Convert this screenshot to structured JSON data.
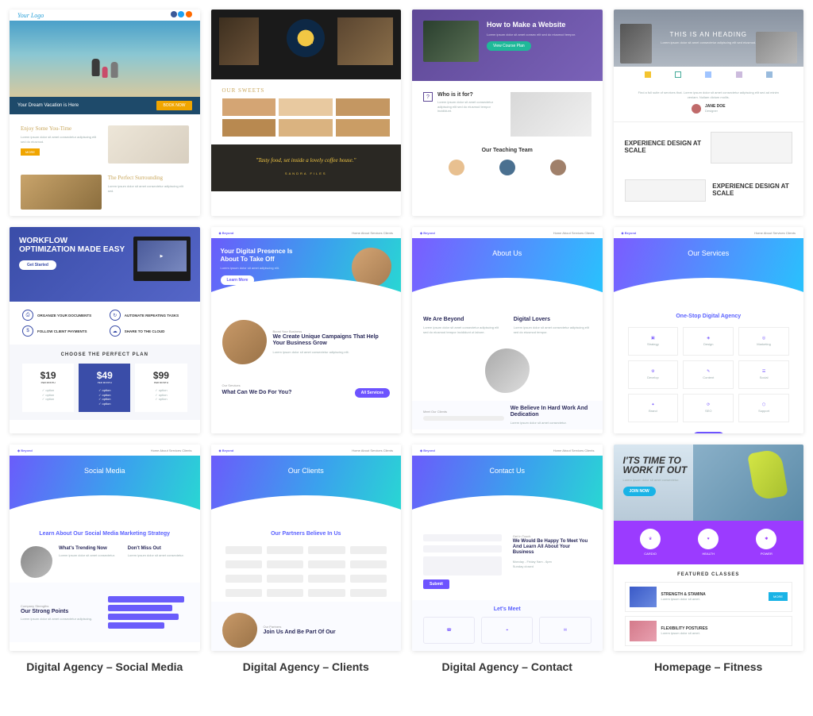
{
  "row1": {
    "vacation": {
      "logo": "Your Logo",
      "hero_text": "Your Dream Vacation is Here",
      "hero_cta": "BOOK NOW",
      "section1": "Enjoy Some You-Time",
      "section2": "The Perfect Surrounding"
    },
    "restaurant": {
      "sweets": "OUR SWEETS",
      "quote": "\"Tasty food, set inside a lovely coffee house.\"",
      "quote_author": "SANDRA FILES"
    },
    "howto": {
      "hero_title": "How to Make a Website",
      "hero_cta": "View Course Plan",
      "who_title": "Who is it for?",
      "team": "Our Teaching Team"
    },
    "heading": {
      "hero": "THIS IS AN HEADING",
      "person": "JANE DOE",
      "exp1": "EXPERIENCE DESIGN AT SCALE",
      "exp2": "EXPERIENCE DESIGN AT SCALE"
    }
  },
  "row2": {
    "workflow": {
      "hero": "WORKFLOW OPTIMIZATION MADE EASY",
      "get_started": "Get Started",
      "feat1": "ORGANIZE YOUR DOCUMENTS",
      "feat2": "AUTOMATE REPEATING TASKS",
      "feat3": "FOLLOW CLIENT PAYMENTS",
      "feat4": "SHARE TO THE CLOUD",
      "plan_heading": "CHOOSE THE PERFECT PLAN",
      "p1": "$19",
      "p1p": "PER MONTH",
      "p2": "$49",
      "p2p": "PER MONTH",
      "p3": "$99",
      "p3p": "PER MONTH"
    },
    "agency_home": {
      "hero1": "Your Digital Presence Is",
      "hero2": "About To Take Off",
      "campaigns": "We Create Unique Campaigns That Help Your Business Grow",
      "what": "What Can We Do For You?"
    },
    "about": {
      "hero": "About Us",
      "sub1": "We Are Beyond",
      "sub2": "Digital Lovers",
      "believe": "We Believe In Hard Work And Dedication"
    },
    "services": {
      "hero": "Our Services",
      "sub": "One-Stop Digital Agency"
    }
  },
  "row3": {
    "social": {
      "hero": "Social Media",
      "sub": "Learn About Our Social Media Marketing Strategy",
      "t1": "What's Trending Now",
      "t2": "Don't Miss Out",
      "strong": "Our Strong Points"
    },
    "clients": {
      "hero": "Our Clients",
      "sub": "Our Partners Believe In Us",
      "join": "Join Us And Be Part Of Our"
    },
    "contact": {
      "hero": "Contact Us",
      "happy": "We Would Be Happy To Meet You And Learn All About Your Business",
      "meet": "Let's Meet"
    },
    "fitness": {
      "hero": "I'TS TIME TO WORK IT OUT",
      "classes": "FEATURED CLASSES",
      "c1": "STRENGTH & STAMINA",
      "c2": "FLEXIBILITY POSTURES"
    }
  },
  "captions": {
    "c1": "Digital Agency – Social Media",
    "c2": "Digital Agency – Clients",
    "c3": "Digital Agency – Contact",
    "c4": "Homepage – Fitness"
  }
}
